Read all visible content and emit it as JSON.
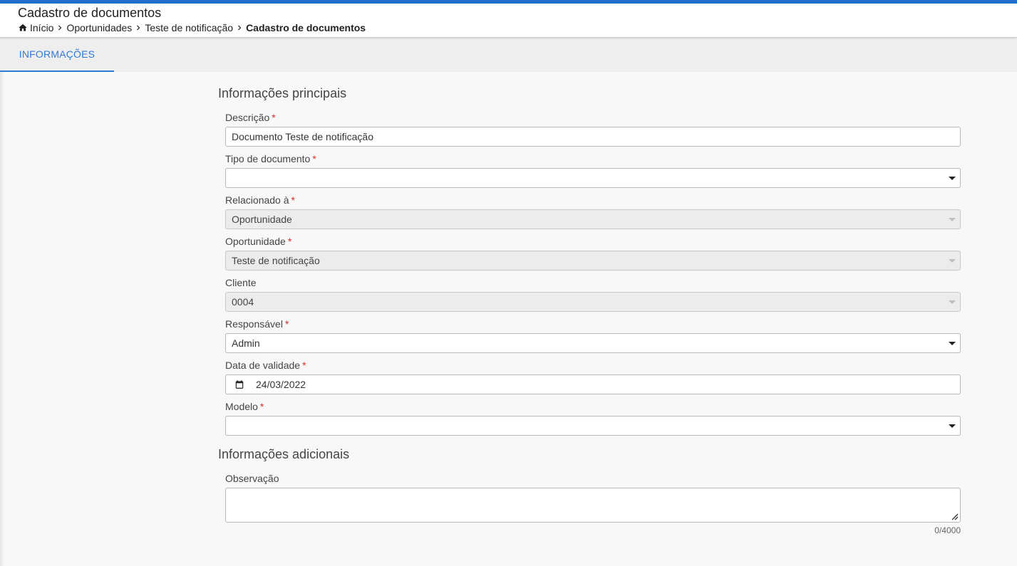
{
  "header": {
    "title": "Cadastro de documentos",
    "breadcrumb": [
      "Início",
      "Oportunidades",
      "Teste de notificação",
      "Cadastro de documentos"
    ]
  },
  "tabs": [
    {
      "label": "INFORMAÇÕES",
      "active": true
    }
  ],
  "sections": {
    "main": "Informações principais",
    "additional": "Informações adicionais"
  },
  "fields": {
    "descricao": {
      "label": "Descrição",
      "required": "*",
      "value": "Documento Teste de notificação"
    },
    "tipo_documento": {
      "label": "Tipo de documento",
      "required": "*",
      "value": ""
    },
    "relacionado": {
      "label": "Relacionado à",
      "required": "*",
      "value": "Oportunidade"
    },
    "oportunidade": {
      "label": "Oportunidade",
      "required": "*",
      "value": "Teste de notificação"
    },
    "cliente": {
      "label": "Cliente",
      "value": "0004"
    },
    "responsavel": {
      "label": "Responsável",
      "required": "*",
      "value": "Admin"
    },
    "data_validade": {
      "label": "Data de validade",
      "required": "*",
      "value": "24/03/2022"
    },
    "modelo": {
      "label": "Modelo",
      "required": "*",
      "value": ""
    },
    "observacao": {
      "label": "Observação",
      "value": "",
      "counter": "0/4000"
    }
  },
  "colors": {
    "accent": "#2f7ad6",
    "topbar": "#1f6fcc",
    "required": "#d32f2f"
  },
  "icons": {
    "home": "home-icon",
    "separator": "chevron-right-icon",
    "dropdown": "caret-down-icon",
    "calendar": "calendar-icon",
    "resize": "resize-handle-icon"
  }
}
